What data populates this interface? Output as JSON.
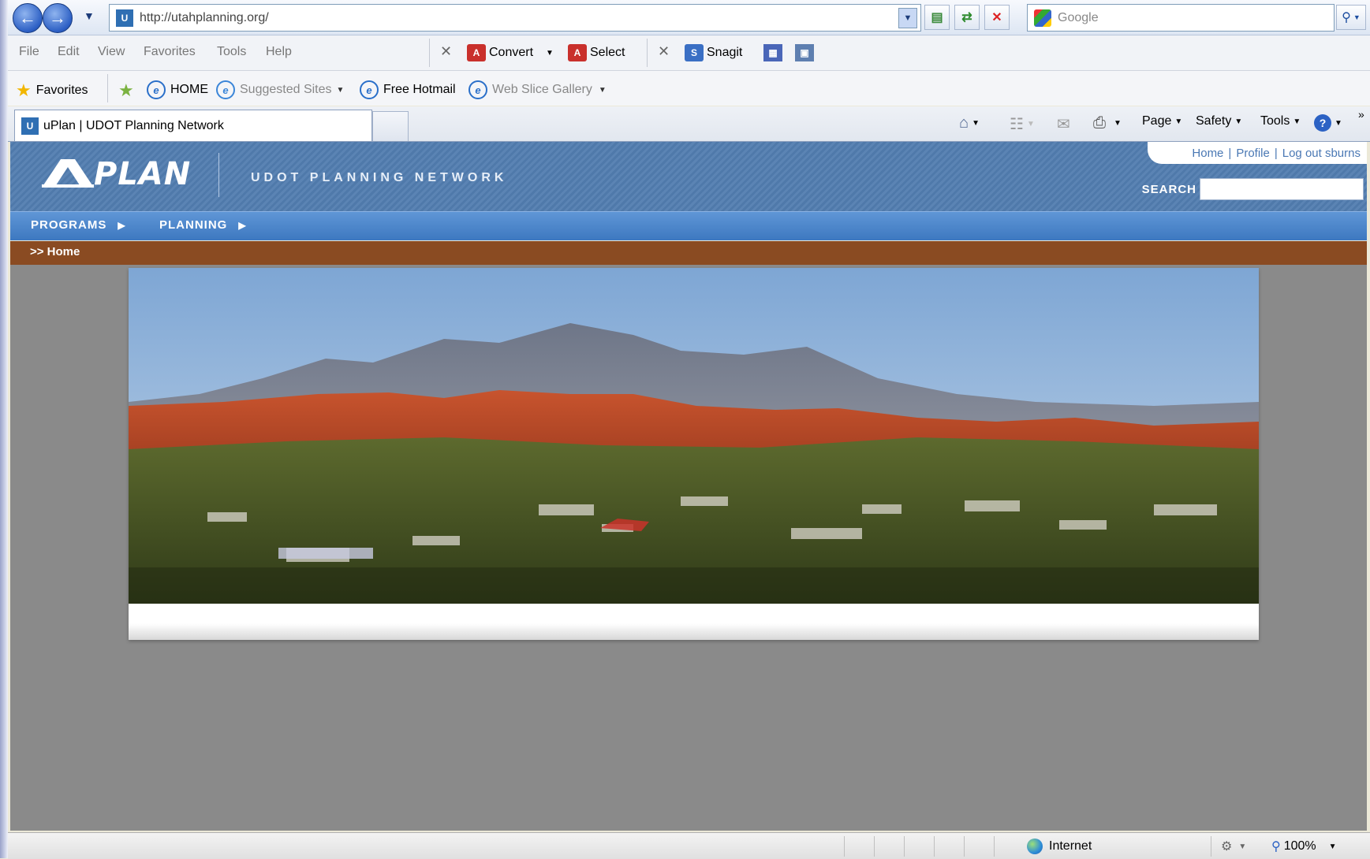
{
  "browser": {
    "url": "http://utahplanning.org/",
    "search_placeholder": "Google",
    "menu": [
      "File",
      "Edit",
      "View",
      "Favorites",
      "Tools",
      "Help"
    ],
    "toolbar": {
      "convert_label": "Convert",
      "select_label": "Select",
      "snagit_label": "Snagit"
    },
    "favorites": {
      "favorites_label": "Favorites",
      "items": [
        "HOME",
        "Suggested Sites",
        "Free Hotmail",
        "Web Slice Gallery"
      ]
    },
    "tab": {
      "title": "uPlan | UDOT Planning Network"
    },
    "commands": {
      "page": "Page",
      "safety": "Safety",
      "tools": "Tools"
    },
    "status": {
      "zone": "Internet",
      "zoom": "100%"
    }
  },
  "site": {
    "logo": "PLAN",
    "tagline": "UDOT PLANNING NETWORK",
    "top_links": [
      "Home",
      "Profile",
      "Log out sburns"
    ],
    "search_label": "SEARCH",
    "search_value": "",
    "nav": [
      "PROGRAMS",
      "PLANNING"
    ],
    "breadcrumb": ">> Home"
  },
  "colors": {
    "header_blue": "#5b84b4",
    "nav_blue": "#4a85cc",
    "breadcrumb_brown": "#8a4b22",
    "content_gray": "#8a8a8a"
  },
  "icons": [
    "back-arrow-icon",
    "forward-arrow-icon",
    "refresh-icon",
    "stop-icon",
    "search-icon",
    "star-icon",
    "ie-page-icon",
    "home-icon",
    "feeds-icon",
    "mail-icon",
    "print-icon",
    "help-icon",
    "globe-icon",
    "zoom-icon"
  ]
}
